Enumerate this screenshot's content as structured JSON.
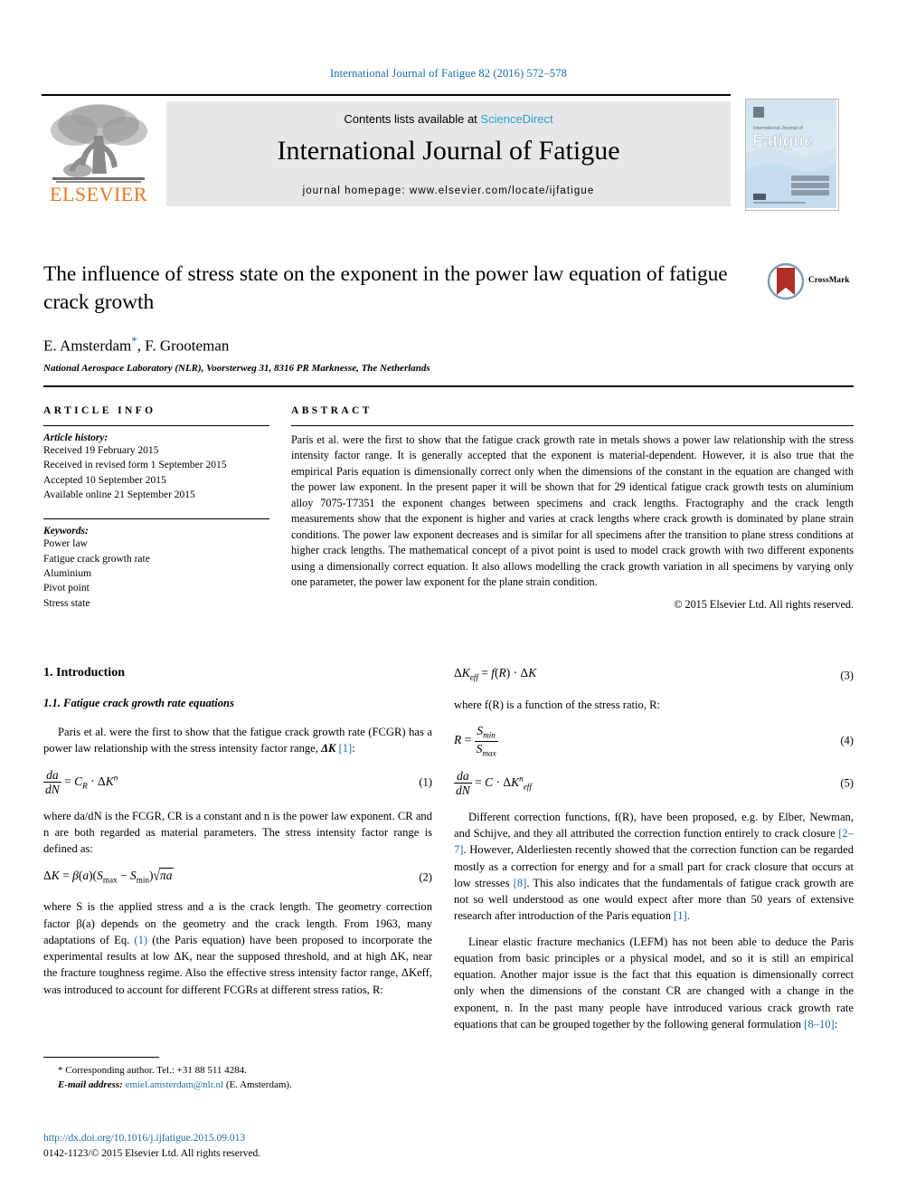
{
  "running_head": "International Journal of Fatigue 82 (2016) 572–578",
  "masthead": {
    "contents_prefix": "Contents lists available at ",
    "sciencedirect": "ScienceDirect",
    "journal_title": "International Journal of Fatigue",
    "homepage": "journal homepage: www.elsevier.com/locate/ijfatigue",
    "publisher_name": "ELSEVIER",
    "cover_journal_line": "International Journal of",
    "cover_title": "Fatigue"
  },
  "title": {
    "text": "The influence of stress state on the exponent in the power law equation of fatigue crack growth",
    "crossmark_label": "CrossMark"
  },
  "authors": {
    "line": "E. Amsterdam",
    "corresponding_mark": "*",
    "line_rest": ", F. Grooteman",
    "affiliation": "National Aerospace Laboratory (NLR), Voorsterweg 31, 8316 PR Marknesse, The Netherlands"
  },
  "article_info": {
    "heading": "ARTICLE INFO",
    "history_label": "Article history:",
    "history": [
      "Received 19 February 2015",
      "Received in revised form 1 September 2015",
      "Accepted 10 September 2015",
      "Available online 21 September 2015"
    ],
    "keywords_label": "Keywords:",
    "keywords": [
      "Power law",
      "Fatigue crack growth rate",
      "Aluminium",
      "Pivot point",
      "Stress state"
    ]
  },
  "abstract": {
    "heading": "ABSTRACT",
    "body": "Paris et al. were the first to show that the fatigue crack growth rate in metals shows a power law relationship with the stress intensity factor range. It is generally accepted that the exponent is material-dependent. However, it is also true that the empirical Paris equation is dimensionally correct only when the dimensions of the constant in the equation are changed with the power law exponent. In the present paper it will be shown that for 29 identical fatigue crack growth tests on aluminium alloy 7075-T7351 the exponent changes between specimens and crack lengths. Fractography and the crack length measurements show that the exponent is higher and varies at crack lengths where crack growth is dominated by plane strain conditions. The power law exponent decreases and is similar for all specimens after the transition to plane stress conditions at higher crack lengths. The mathematical concept of a pivot point is used to model crack growth with two different exponents using a dimensionally correct equation. It also allows modelling the crack growth variation in all specimens by varying only one parameter, the power law exponent for the plane strain condition.",
    "copyright": "© 2015 Elsevier Ltd. All rights reserved."
  },
  "body": {
    "section1_heading": "1. Introduction",
    "subsection11_heading": "1.1. Fatigue crack growth rate equations",
    "p1_a": "Paris et al. were the first to show that the fatigue crack growth rate (FCGR) has a power law relationship with the stress intensity factor range, ",
    "p1_sym": "ΔK",
    "p1_ref": "[1]",
    "p1_b": ":",
    "eq1_num": "(1)",
    "p2": "where da/dN is the FCGR, CR is a constant and n is the power law exponent. CR and n are both regarded as material parameters. The stress intensity factor range is defined as:",
    "eq2_num": "(2)",
    "p3_a": "where S is the applied stress and a is the crack length. The geometry correction factor β(a) depends on the geometry and the crack length. From 1963, many adaptations of Eq. ",
    "p3_ref": "(1)",
    "p3_b": " (the Paris equation) have been proposed to incorporate the experimental results at low ΔK, near the supposed threshold, and at high ΔK, near the fracture toughness regime. Also the effective stress intensity factor range, ΔKeff, was introduced to account for different FCGRs at different stress ratios, R:",
    "eq3_num": "(3)",
    "p4": "where f(R) is a function of the stress ratio, R:",
    "eq4_num": "(4)",
    "eq5_num": "(5)",
    "p5_a": "Different correction functions, f(R), have been proposed, e.g. by Elber, Newman, and Schijve, and they all attributed the correction function entirely to crack closure ",
    "p5_ref1": "[2–7]",
    "p5_b": ". However, Alderliesten recently showed that the correction function can be regarded mostly as a correction for energy and for a small part for crack closure that occurs at low stresses ",
    "p5_ref2": "[8]",
    "p5_c": ". This also indicates that the fundamentals of fatigue crack growth are not so well understood as one would expect after more than 50 years of extensive research after introduction of the Paris equation ",
    "p5_ref3": "[1]",
    "p5_d": ".",
    "p6_a": "Linear elastic fracture mechanics (LEFM) has not been able to deduce the Paris equation from basic principles or a physical model, and so it is still an empirical equation. Another major issue is the fact that this equation is dimensionally correct only when the dimensions of the constant CR are changed with a change in the exponent, n. In the past many people have introduced various crack growth rate equations that can be grouped together by the following general formulation ",
    "p6_ref": "[8–10]",
    "p6_b": ":"
  },
  "footnote": {
    "star": "*",
    "corresponding": " Corresponding author. Tel.: +31 88 511 4284.",
    "email_label": "E-mail address:",
    "email": "emiel.amsterdam@nlr.nl",
    "email_suffix": " (E. Amsterdam)."
  },
  "doi": {
    "url": "http://dx.doi.org/10.1016/j.ijfatigue.2015.09.013",
    "issn_line": "0142-1123/© 2015 Elsevier Ltd. All rights reserved."
  },
  "colors": {
    "link_blue": "#1b6ca8",
    "sciencedirect_blue": "#2e9fd4",
    "elsevier_orange": "#e87722",
    "band_gray": "#e6e7e8",
    "crossmark_red": "#b03028"
  }
}
